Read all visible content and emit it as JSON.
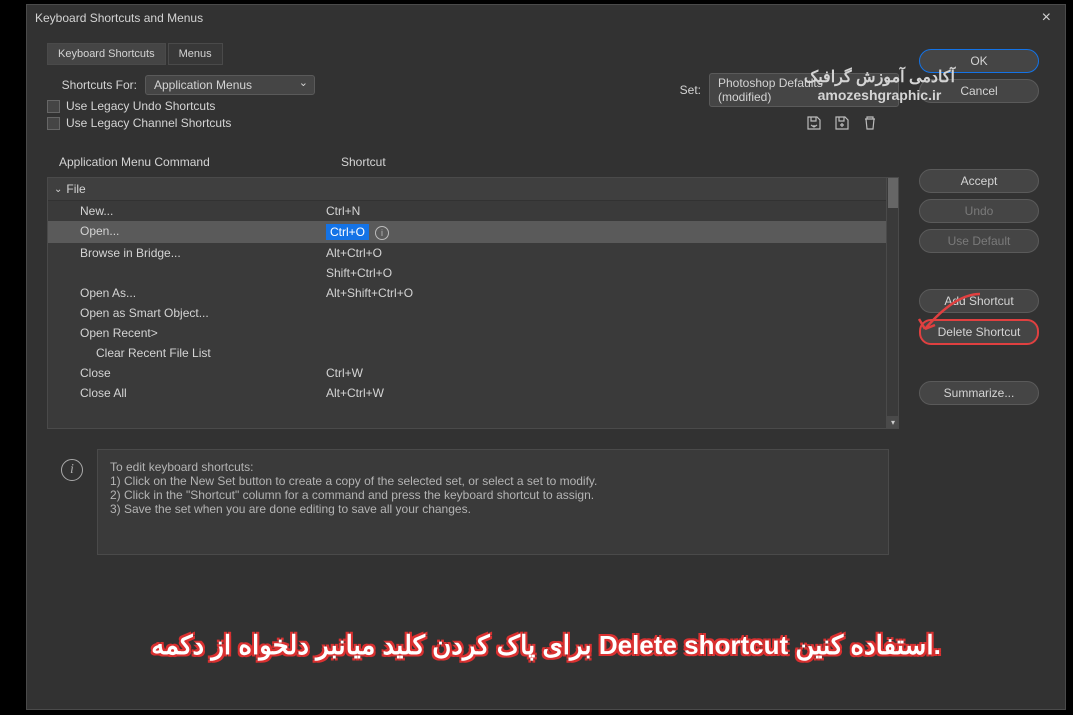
{
  "titlebar": {
    "title": "Keyboard Shortcuts and Menus"
  },
  "tabs": {
    "shortcuts": "Keyboard Shortcuts",
    "menus": "Menus"
  },
  "form": {
    "shortcuts_for_label": "Shortcuts For:",
    "shortcuts_for_value": "Application Menus",
    "set_label": "Set:",
    "set_value": "Photoshop Defaults (modified)",
    "legacy_undo": "Use Legacy Undo Shortcuts",
    "legacy_channel": "Use Legacy Channel Shortcuts"
  },
  "headers": {
    "command": "Application Menu Command",
    "shortcut": "Shortcut"
  },
  "tree_section": "File",
  "rows": [
    {
      "cmd": "New...",
      "sc": "Ctrl+N",
      "selected": false
    },
    {
      "cmd": "Open...",
      "sc": "Ctrl+O",
      "selected": true,
      "editing": true
    },
    {
      "cmd": "Browse in Bridge...",
      "sc": "Alt+Ctrl+O",
      "selected": false
    },
    {
      "cmd": "",
      "sc": "Shift+Ctrl+O",
      "selected": false
    },
    {
      "cmd": "Open As...",
      "sc": "Alt+Shift+Ctrl+O",
      "selected": false
    },
    {
      "cmd": "Open as Smart Object...",
      "sc": "",
      "selected": false
    },
    {
      "cmd": "Open Recent>",
      "sc": "",
      "selected": false
    },
    {
      "cmd": "Clear Recent File List",
      "sc": "",
      "selected": false,
      "indent": true
    },
    {
      "cmd": "Close",
      "sc": "Ctrl+W",
      "selected": false
    },
    {
      "cmd": "Close All",
      "sc": "Alt+Ctrl+W",
      "selected": false
    }
  ],
  "buttons": {
    "ok": "OK",
    "cancel": "Cancel",
    "accept": "Accept",
    "undo": "Undo",
    "use_default": "Use Default",
    "add_shortcut": "Add Shortcut",
    "delete_shortcut": "Delete Shortcut",
    "summarize": "Summarize..."
  },
  "info": {
    "l1": "To edit keyboard shortcuts:",
    "l2": "1) Click on the New Set button to create a copy of the selected set, or select a set to modify.",
    "l3": "2) Click in the \"Shortcut\" column for a command and press the keyboard shortcut to assign.",
    "l4": "3) Save the set when you are done editing to save all your changes."
  },
  "watermark": {
    "line1": "آکادمی آموزش گرافیک",
    "line2": "amozeshgraphic.ir"
  },
  "caption": "برای پاک کردن  کلید میانبر دلخواه از دکمه Delete shortcut استفاده کنین."
}
